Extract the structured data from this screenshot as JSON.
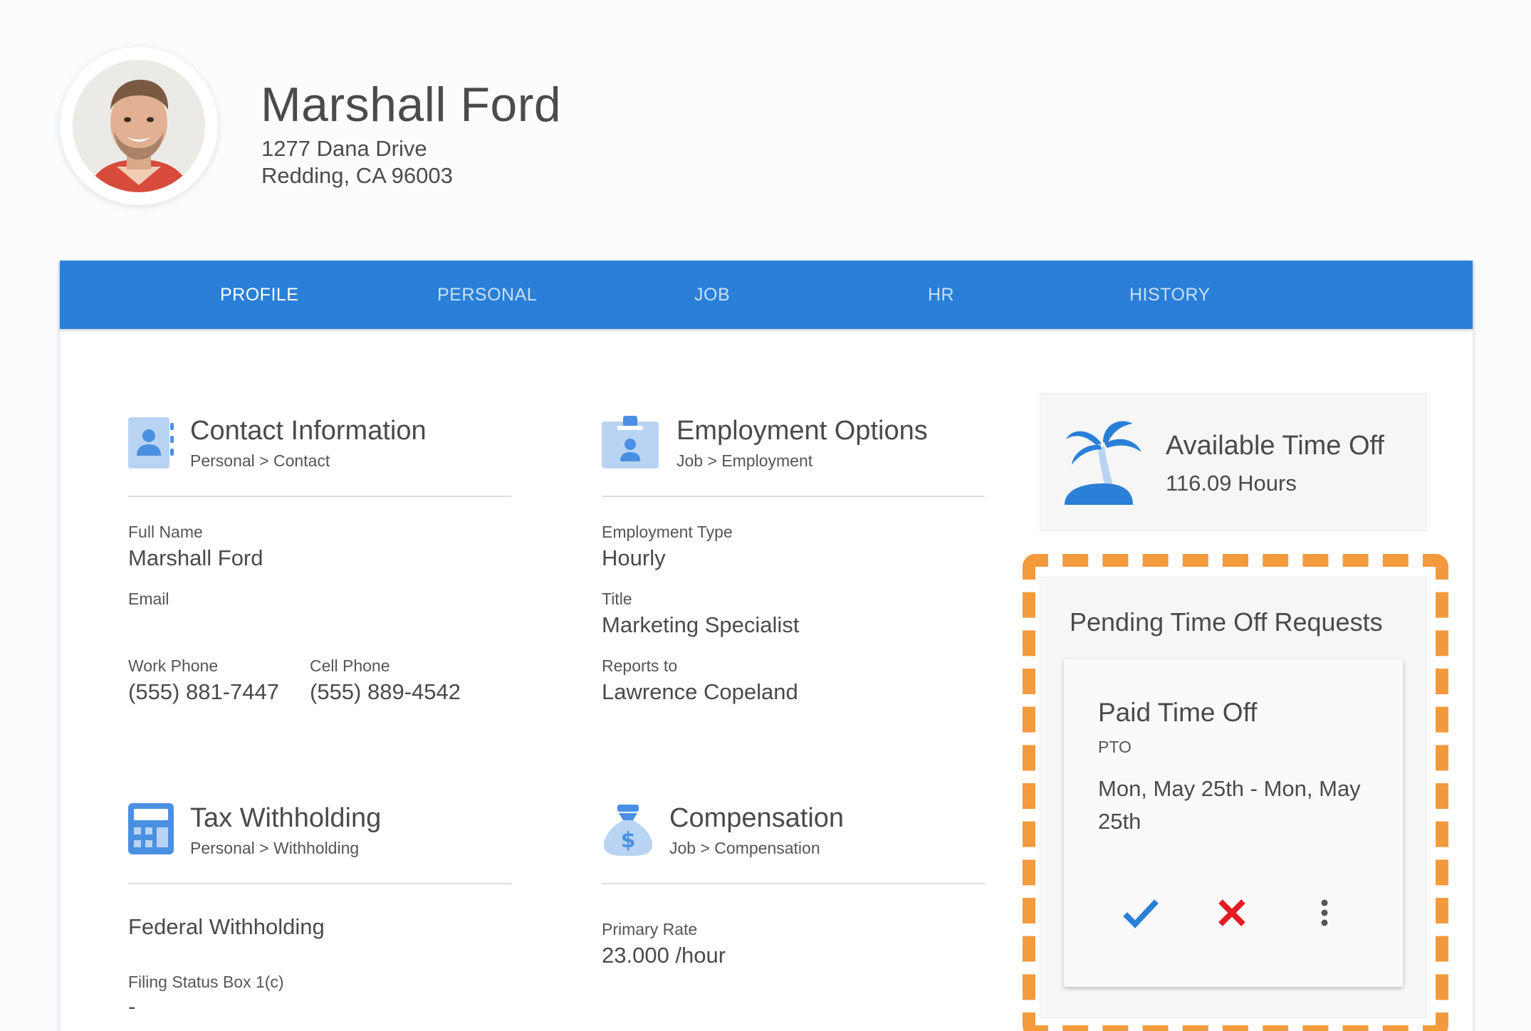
{
  "header": {
    "name": "Marshall Ford",
    "address_line1": "1277 Dana Drive",
    "address_line2": "Redding, CA 96003"
  },
  "tabs": [
    {
      "label": "PROFILE",
      "active": true
    },
    {
      "label": "PERSONAL",
      "active": false
    },
    {
      "label": "JOB",
      "active": false
    },
    {
      "label": "HR",
      "active": false
    },
    {
      "label": "HISTORY",
      "active": false
    }
  ],
  "contact": {
    "title": "Contact Information",
    "breadcrumb": "Personal > Contact",
    "icon": "contact-card-icon",
    "full_name_label": "Full Name",
    "full_name": "Marshall Ford",
    "email_label": "Email",
    "email": "",
    "work_phone_label": "Work Phone",
    "work_phone": "(555) 881-7447",
    "cell_phone_label": "Cell Phone",
    "cell_phone": "(555) 889-4542"
  },
  "employment": {
    "title": "Employment Options",
    "breadcrumb": "Job > Employment",
    "icon": "id-badge-icon",
    "type_label": "Employment Type",
    "type": "Hourly",
    "title_label": "Title",
    "job_title": "Marketing Specialist",
    "reports_label": "Reports to",
    "reports_to": "Lawrence Copeland"
  },
  "tax": {
    "title": "Tax Withholding",
    "breadcrumb": "Personal > Withholding",
    "icon": "calculator-icon",
    "federal_heading": "Federal Withholding",
    "filing_label": "Filing Status Box 1(c)",
    "filing_value": "-"
  },
  "compensation": {
    "title": "Compensation",
    "breadcrumb": "Job > Compensation",
    "icon": "money-bag-icon",
    "rate_label": "Primary Rate",
    "rate": "23.000 /hour"
  },
  "available_time_off": {
    "title": "Available Time Off",
    "hours": "116.09 Hours",
    "icon": "palm-tree-icon"
  },
  "pending": {
    "title": "Pending Time Off Requests",
    "request": {
      "type": "Paid Time Off",
      "code": "PTO",
      "dates_line1": "Mon, May 25th - Mon, May",
      "dates_line2": "25th"
    }
  },
  "colors": {
    "accent": "#2a80d8",
    "icon_blue": "#4a90e2",
    "highlight_orange": "#f39a3c",
    "approve_blue": "#2a7fd6",
    "deny_red": "#e31b23"
  }
}
